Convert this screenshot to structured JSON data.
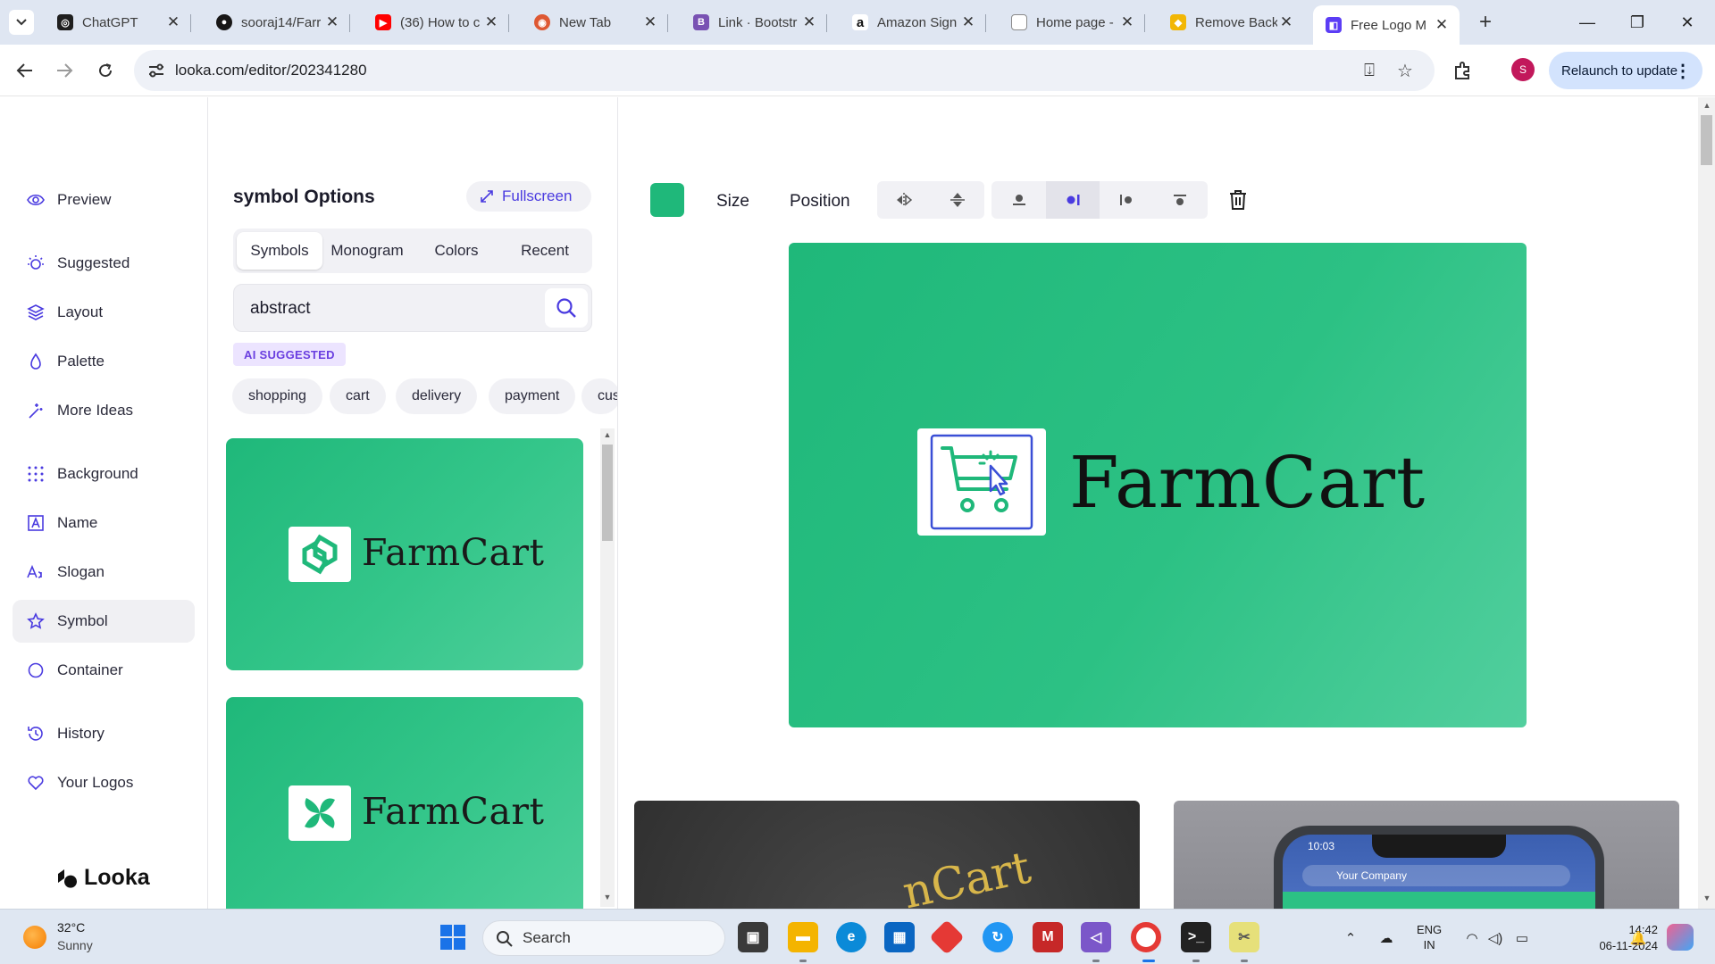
{
  "browser": {
    "tabs": [
      {
        "label": "ChatGPT",
        "icon": "chatgpt-icon",
        "color": "#1f1f1f"
      },
      {
        "label": "sooraj14/Farr",
        "icon": "github-icon",
        "color": "#181717"
      },
      {
        "label": "(36) How to c",
        "icon": "youtube-icon",
        "color": "#ff0000"
      },
      {
        "label": "New Tab",
        "icon": "duckduckgo-icon",
        "color": "#de5833"
      },
      {
        "label": "Link · Bootstr",
        "icon": "bootstrap-icon",
        "color": "#7952b3"
      },
      {
        "label": "Amazon Sign",
        "icon": "amazon-icon",
        "color": "#111111"
      },
      {
        "label": "Home page -",
        "icon": "page-icon",
        "color": "#8a8a8a"
      },
      {
        "label": "Remove Back",
        "icon": "removebg-icon",
        "color": "#f2b705"
      },
      {
        "label": "Free Logo M",
        "icon": "looka-icon",
        "color": "#5b3df5",
        "active": true
      }
    ],
    "url": "looka.com/editor/202341280",
    "relaunch_label": "Relaunch to update",
    "profile_initial": "S"
  },
  "nav": {
    "items": [
      {
        "label": "Preview",
        "icon": "eye-icon"
      },
      {
        "label": "Suggested",
        "icon": "sparkle-icon"
      },
      {
        "label": "Layout",
        "icon": "layers-icon"
      },
      {
        "label": "Palette",
        "icon": "droplet-icon"
      },
      {
        "label": "More Ideas",
        "icon": "wand-icon"
      },
      {
        "label": "Background",
        "icon": "grid-icon"
      },
      {
        "label": "Name",
        "icon": "text-box-icon"
      },
      {
        "label": "Slogan",
        "icon": "font-icon"
      },
      {
        "label": "Symbol",
        "icon": "star-icon",
        "active": true
      },
      {
        "label": "Container",
        "icon": "circle-icon"
      },
      {
        "label": "History",
        "icon": "history-icon"
      },
      {
        "label": "Your Logos",
        "icon": "heart-icon"
      }
    ],
    "brand": "Looka"
  },
  "options": {
    "title": "symbol Options",
    "fullscreen_label": "Fullscreen",
    "tabs": [
      "Symbols",
      "Monogram",
      "Colors",
      "Recent"
    ],
    "active_tab": "Symbols",
    "search_value": "abstract",
    "ai_badge": "AI SUGGESTED",
    "chips": [
      "shopping",
      "cart",
      "delivery",
      "payment",
      "cus"
    ],
    "results": [
      {
        "name": "FarmCart",
        "symbol": "abstract-swirl-icon"
      },
      {
        "name": "FarmCart",
        "symbol": "pinwheel-icon"
      }
    ]
  },
  "editor": {
    "color": "#1fb87a",
    "size_label": "Size",
    "position_label": "Position",
    "logo_name": "FarmCart",
    "logo_symbol": "cart-click-icon",
    "mockup_card_text": "nCart",
    "mockup_phone": {
      "time": "10:03",
      "search_placeholder": "Your Company"
    }
  },
  "taskbar": {
    "weather_temp": "32°C",
    "weather_condition": "Sunny",
    "search_placeholder": "Search",
    "lang_line1": "ENG",
    "lang_line2": "IN",
    "time": "14:42",
    "date": "06-11-2024"
  }
}
